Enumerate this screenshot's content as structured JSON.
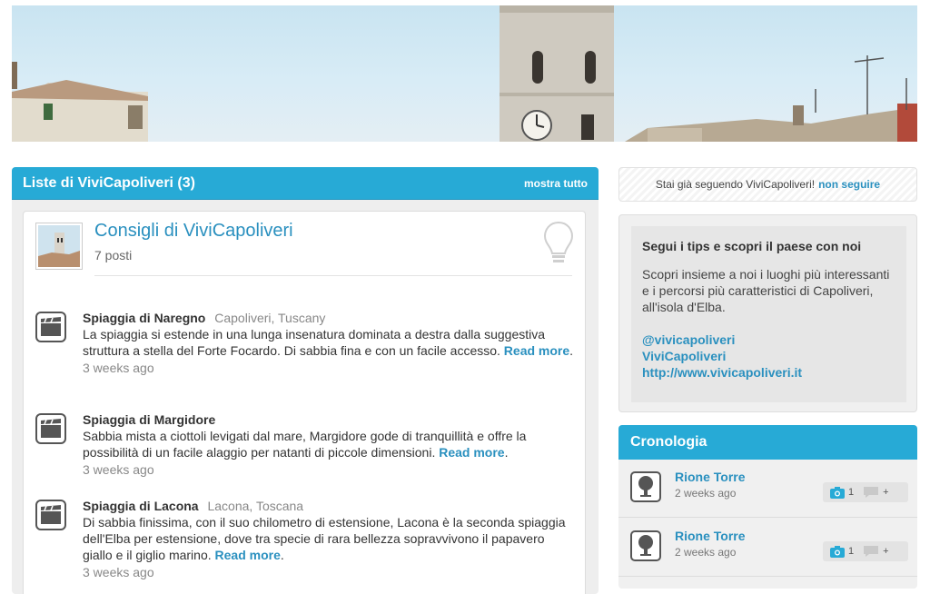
{
  "lists": {
    "title": "Liste di ViviCapoliveri (3)",
    "show_all": "mostra tutto",
    "list": {
      "name": "Consigli di ViviCapoliveri",
      "count": "7 posti"
    },
    "tips": [
      {
        "title": "Spiaggia di Naregno",
        "location": "Capoliveri, Tuscany",
        "text": "La spiaggia si estende in una lunga insenatura dominata a destra dalla suggestiva struttura a stella del Forte Focardo. Di sabbia fina e con un facile accesso.",
        "read_more": "Read more",
        "time": "3 weeks ago"
      },
      {
        "title": "Spiaggia di Margidore",
        "location": "",
        "text": "Sabbia mista a ciottoli levigati dal mare, Margidore gode di tranquillità e offre la possibilità di un facile alaggio per natanti di piccole dimensioni.",
        "read_more": "Read more",
        "time": "3 weeks ago"
      },
      {
        "title": "Spiaggia di Lacona",
        "location": "Lacona, Toscana",
        "text": "Di sabbia finissima, con il suo chilometro di estensione, Lacona è la seconda spiaggia dell'Elba per estensione, dove tra specie di rara bellezza sopravvivono il papavero giallo e il giglio marino.",
        "read_more": "Read more",
        "time": "3 weeks ago"
      }
    ]
  },
  "follow": {
    "text": "Stai già seguendo ViviCapoliveri!",
    "unfollow": "non seguire"
  },
  "about": {
    "title": "Segui i tips e scopri il paese con noi",
    "text": "Scopri insieme a noi i luoghi più interessanti e i percorsi più caratteristici di Capoliveri, all'isola d'Elba.",
    "links": [
      "@vivicapoliveri",
      "ViviCapoliveri",
      "http://www.vivicapoliveri.it"
    ]
  },
  "chronology": {
    "title": "Cronologia",
    "items": [
      {
        "title": "Rione Torre",
        "time": "2 weeks ago",
        "photos": "1",
        "comments": "+"
      },
      {
        "title": "Rione Torre",
        "time": "2 weeks ago",
        "photos": "1",
        "comments": "+"
      }
    ]
  },
  "colors": {
    "accent": "#27aad6",
    "link": "#2a90bf"
  }
}
